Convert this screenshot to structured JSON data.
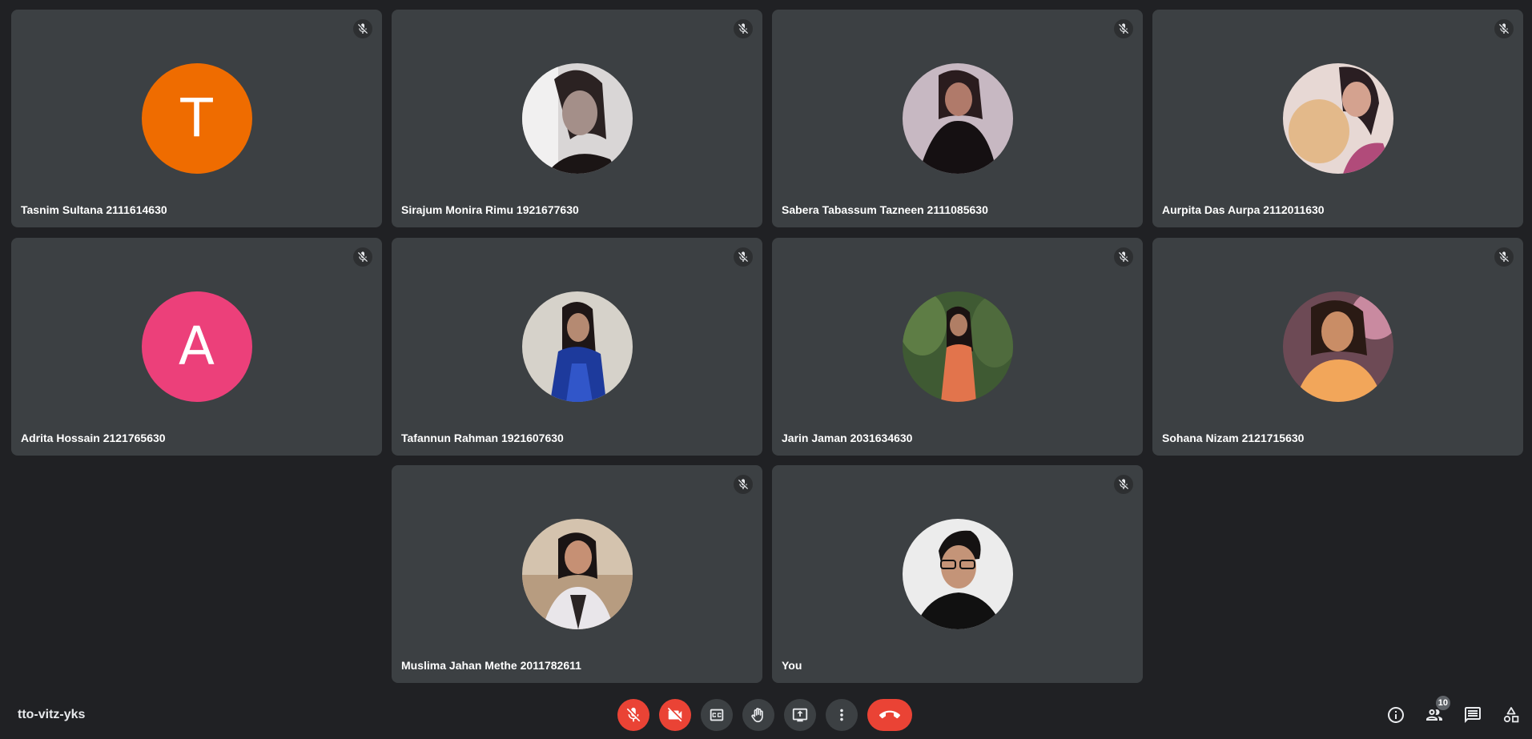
{
  "participants": [
    {
      "name": "Tasnim Sultana 2111614630",
      "initial": "T",
      "avatar_color": "#ef6c00",
      "muted": true
    },
    {
      "name": "Sirajum Monira Rimu 1921677630",
      "initial": "",
      "avatar_color": "#8a8a8a",
      "muted": true
    },
    {
      "name": "Sabera Tabassum Tazneen 2111085630",
      "initial": "",
      "avatar_color": "#b7a4ad",
      "muted": true
    },
    {
      "name": "Aurpita Das Aurpa 2112011630",
      "initial": "",
      "avatar_color": "#d8c5b5",
      "muted": true
    },
    {
      "name": "Adrita Hossain 2121765630",
      "initial": "A",
      "avatar_color": "#ec407a",
      "muted": true
    },
    {
      "name": "Tafannun Rahman 1921607630",
      "initial": "",
      "avatar_color": "#cfcac2",
      "muted": true
    },
    {
      "name": "Jarin Jaman 2031634630",
      "initial": "",
      "avatar_color": "#4b6b3a",
      "muted": true
    },
    {
      "name": "Sohana Nizam 2121715630",
      "initial": "",
      "avatar_color": "#c88a4a",
      "muted": true
    },
    {
      "name": "Muslima Jahan Methe 2011782611",
      "initial": "",
      "avatar_color": "#c9b9a6",
      "muted": true
    },
    {
      "name": "You",
      "initial": "",
      "avatar_color": "#eeeeee",
      "muted": true
    }
  ],
  "meeting": {
    "code": "tto-vitz-yks",
    "participant_count": "10"
  },
  "colors": {
    "background": "#202124",
    "tile": "#3c4043",
    "danger": "#ea4335"
  },
  "controls": [
    {
      "name": "mic-off-button",
      "icon": "mic-off-icon"
    },
    {
      "name": "camera-off-button",
      "icon": "videocam-off-icon"
    },
    {
      "name": "captions-button",
      "icon": "captions-icon"
    },
    {
      "name": "raise-hand-button",
      "icon": "hand-icon"
    },
    {
      "name": "present-screen-button",
      "icon": "present-icon"
    },
    {
      "name": "more-options-button",
      "icon": "more-vert-icon"
    },
    {
      "name": "leave-call-button",
      "icon": "call-end-icon"
    }
  ],
  "side_icons": [
    "info-icon",
    "people-icon",
    "chat-icon",
    "activities-icon"
  ]
}
